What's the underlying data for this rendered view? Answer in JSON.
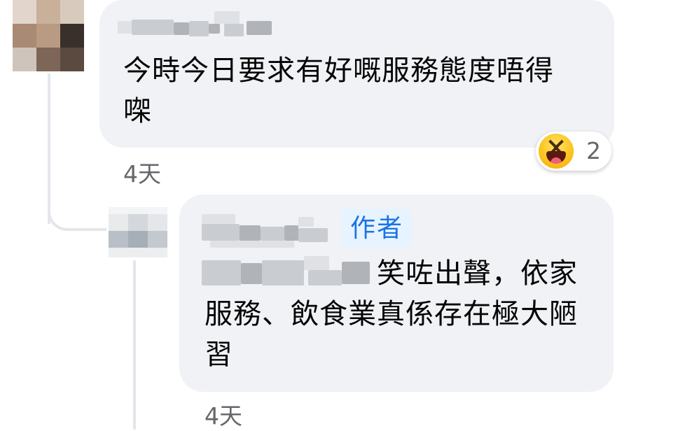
{
  "comment": {
    "text": "今時今日要求有好嘅服務態度唔得㗎",
    "timestamp": "4天",
    "reaction": {
      "icon": "laughing-face-icon",
      "count": "2"
    }
  },
  "reply": {
    "badge": "作者",
    "text": "笑咗出聲，依家服務、飲食業真係存在極大陋習",
    "timestamp": "4天"
  }
}
